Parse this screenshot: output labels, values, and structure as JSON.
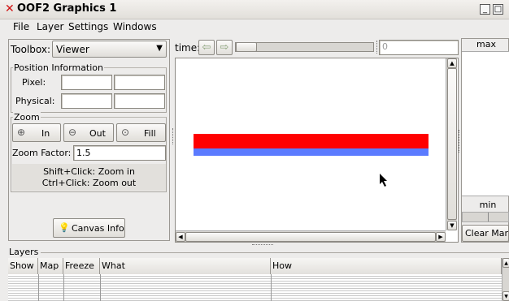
{
  "window": {
    "close_glyph": "✕",
    "title": "OOF2 Graphics 1"
  },
  "menubar": {
    "items": [
      "File",
      "Layer",
      "Settings",
      "Windows"
    ]
  },
  "toolbox": {
    "label": "Toolbox:",
    "selected": "Viewer"
  },
  "position": {
    "title": "Position Information",
    "pixel_label": "Pixel:",
    "physical_label": "Physical:",
    "pixel_x": "",
    "pixel_y": "",
    "physical_x": "",
    "physical_y": ""
  },
  "zoom": {
    "title": "Zoom",
    "in_label": "In",
    "out_label": "Out",
    "fill_label": "Fill",
    "factor_label": "Zoom Factor:",
    "factor_value": "1.5",
    "hint_line1": "Shift+Click: Zoom in",
    "hint_line2": "Ctrl+Click: Zoom out"
  },
  "canvas_info_label": "Canvas Info",
  "time": {
    "label": "time:",
    "value": "0"
  },
  "canvas": {
    "colors": {
      "red_band": "#ff0000",
      "blue_band": "#5b7bff"
    }
  },
  "colorbar": {
    "max_label": "max",
    "min_label": "min",
    "clear_label": "Clear Mark"
  },
  "layers": {
    "title": "Layers",
    "columns": [
      "Show",
      "Map",
      "Freeze",
      "What",
      "How"
    ]
  }
}
